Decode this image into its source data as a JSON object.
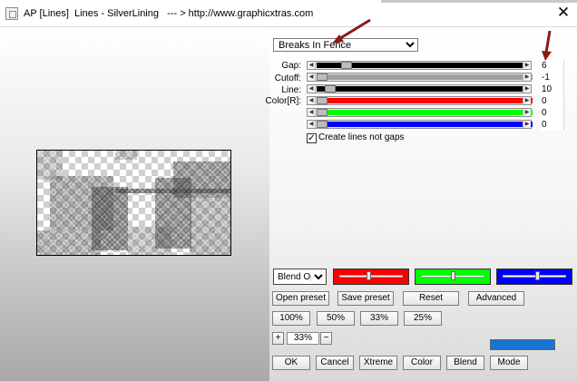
{
  "window": {
    "title": "AP [Lines]  Lines - SilverLining   --- > http://www.graphicxtras.com",
    "close_glyph": "✕"
  },
  "preset": {
    "selected": "Breaks In Fence",
    "options": [
      "Breaks In Fence"
    ]
  },
  "sliders": [
    {
      "id": "gap",
      "label": "Gap:",
      "value": "6",
      "fill_color": "#000000",
      "level": 0.12
    },
    {
      "id": "cutoff",
      "label": "Cutoff:",
      "value": "-1",
      "fill_color": "#a0a0a0",
      "level": 0.0
    },
    {
      "id": "line",
      "label": "Line:",
      "value": "10",
      "fill_color": "#000000",
      "level": 0.04
    },
    {
      "id": "color-r",
      "label": "Color[R]:",
      "value": "0",
      "fill_color": "#ff0000",
      "level": 0.0
    },
    {
      "id": "color-g",
      "label": "",
      "value": "0",
      "fill_color": "#00ff00",
      "level": 0.0
    },
    {
      "id": "color-b",
      "label": "",
      "value": "0",
      "fill_color": "#0000ff",
      "level": 0.0
    }
  ],
  "checkbox": {
    "label": "Create lines not gaps",
    "checked": true,
    "mark": "✓"
  },
  "blend": {
    "selected": "Blend Optio",
    "options": [
      "Blend Optio"
    ],
    "swatches": [
      {
        "color": "#ff0000",
        "level": 0.45
      },
      {
        "color": "#00ff00",
        "level": 0.5
      },
      {
        "color": "#0000ff",
        "level": 0.55
      }
    ]
  },
  "buttons": {
    "open_preset": "Open preset",
    "save_preset": "Save preset",
    "reset": "Reset",
    "advanced": "Advanced",
    "zoom_100": "100%",
    "zoom_50": "50%",
    "zoom_33": "33%",
    "zoom_25": "25%",
    "plus": "+",
    "minus": "−",
    "ok": "OK",
    "cancel": "Cancel",
    "xtreme": "Xtreme",
    "color": "Color",
    "blend": "Blend",
    "mode": "Mode"
  },
  "zoom": {
    "value": "33%"
  },
  "colors": {
    "accent_blue": "#1874d2",
    "annotation_arrow": "#8b1a1a"
  }
}
